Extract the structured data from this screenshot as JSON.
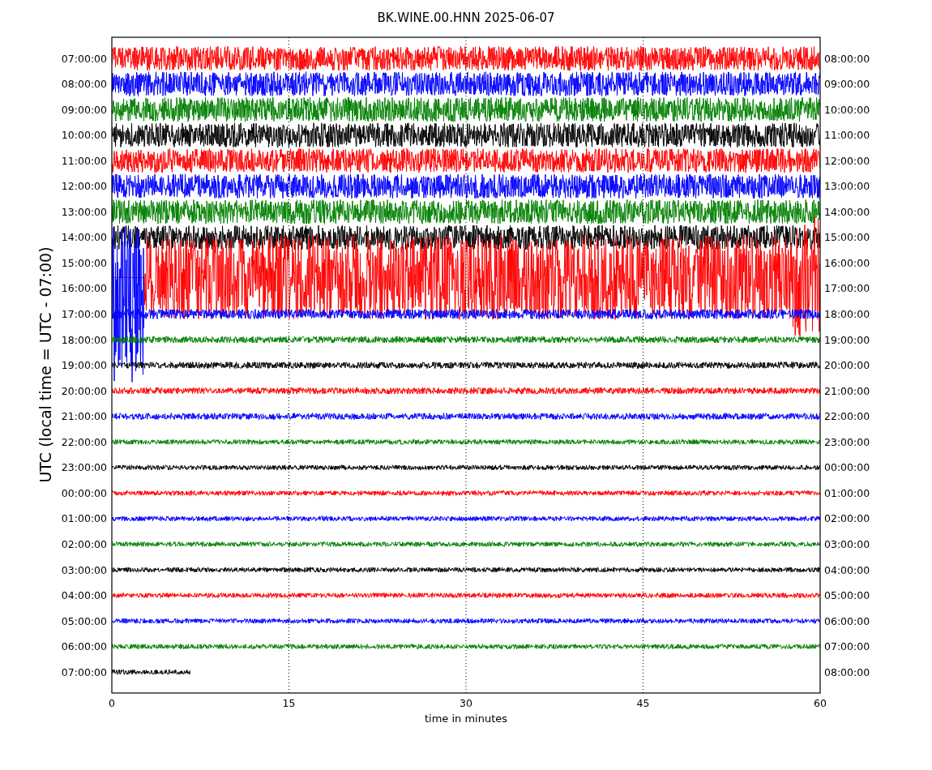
{
  "title": "BK.WINE.00.HNN 2025-06-07",
  "ylabel": "UTC (local time = UTC - 07:00)",
  "xlabel": "time in minutes",
  "xticks": [
    "0",
    "15",
    "30",
    "45",
    "60"
  ],
  "rows": [
    {
      "left": "07:00:00",
      "right": "08:00:00",
      "color": "#ff0000"
    },
    {
      "left": "08:00:00",
      "right": "09:00:00",
      "color": "#0000ff"
    },
    {
      "left": "09:00:00",
      "right": "10:00:00",
      "color": "#008000"
    },
    {
      "left": "10:00:00",
      "right": "11:00:00",
      "color": "#000000"
    },
    {
      "left": "11:00:00",
      "right": "12:00:00",
      "color": "#ff0000"
    },
    {
      "left": "12:00:00",
      "right": "13:00:00",
      "color": "#0000ff"
    },
    {
      "left": "13:00:00",
      "right": "14:00:00",
      "color": "#008000"
    },
    {
      "left": "14:00:00",
      "right": "15:00:00",
      "color": "#000000"
    },
    {
      "left": "15:00:00",
      "right": "16:00:00",
      "color": "#ff0000"
    },
    {
      "left": "16:00:00",
      "right": "17:00:00",
      "color": "#0000ff"
    },
    {
      "left": "17:00:00",
      "right": "18:00:00",
      "color": "#0000ff"
    },
    {
      "left": "18:00:00",
      "right": "19:00:00",
      "color": "#008000"
    },
    {
      "left": "19:00:00",
      "right": "20:00:00",
      "color": "#000000"
    },
    {
      "left": "20:00:00",
      "right": "21:00:00",
      "color": "#ff0000"
    },
    {
      "left": "21:00:00",
      "right": "22:00:00",
      "color": "#0000ff"
    },
    {
      "left": "22:00:00",
      "right": "23:00:00",
      "color": "#008000"
    },
    {
      "left": "23:00:00",
      "right": "00:00:00",
      "color": "#000000"
    },
    {
      "left": "00:00:00",
      "right": "01:00:00",
      "color": "#ff0000"
    },
    {
      "left": "01:00:00",
      "right": "02:00:00",
      "color": "#0000ff"
    },
    {
      "left": "02:00:00",
      "right": "03:00:00",
      "color": "#008000"
    },
    {
      "left": "03:00:00",
      "right": "04:00:00",
      "color": "#000000"
    },
    {
      "left": "04:00:00",
      "right": "05:00:00",
      "color": "#ff0000"
    },
    {
      "left": "05:00:00",
      "right": "06:00:00",
      "color": "#0000ff"
    },
    {
      "left": "06:00:00",
      "right": "07:00:00",
      "color": "#008000"
    },
    {
      "left": "07:00:00",
      "right": "08:00:00",
      "color": "#000000"
    }
  ]
}
